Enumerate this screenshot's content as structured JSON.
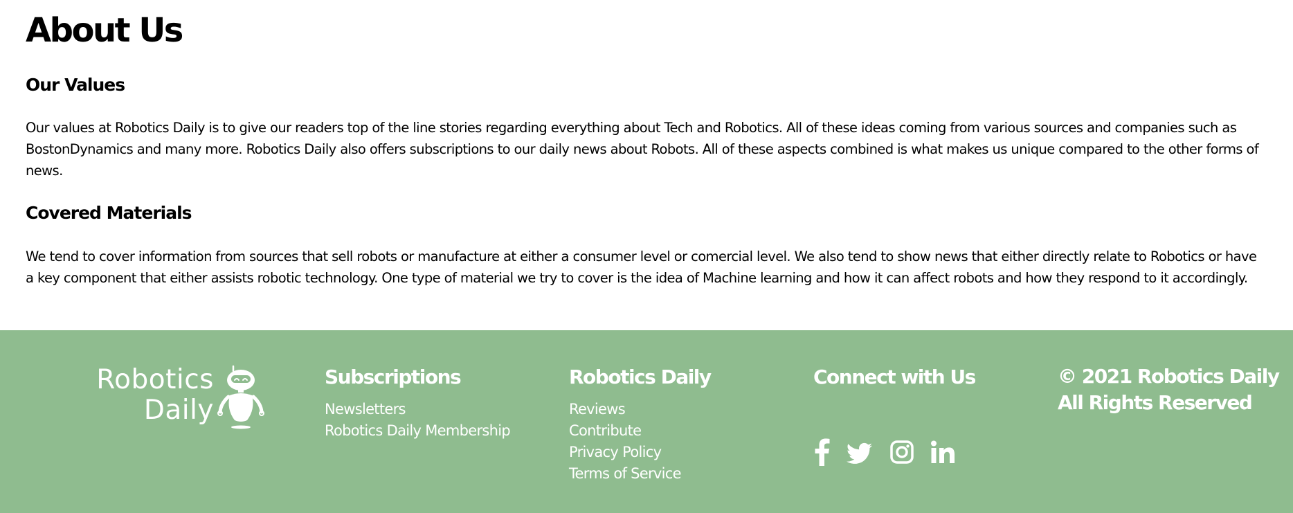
{
  "main": {
    "title": "About Us",
    "sections": [
      {
        "heading": "Our Values",
        "text": "Our values at Robotics Daily is to give our readers top of the line stories regarding everything about Tech and Robotics. All of these ideas coming from various sources and companies such as BostonDynamics and many more. Robotics Daily also offers subscriptions to our daily news about Robots. All of these aspects combined is what makes us unique compared to the other forms of news."
      },
      {
        "heading": "Covered Materials",
        "text": "We tend to cover information from sources that sell robots or manufacture at either a consumer level or comercial level. We also tend to show news that either directly relate to Robotics or have a key component that either assists robotic technology. One type of material we try to cover is the idea of Machine learning and how it can affect robots and how they respond to it accordingly."
      }
    ]
  },
  "footer": {
    "background_color": "#8fbc8f",
    "text_color": "#ffffff",
    "logo": {
      "line1": "Robotics",
      "line2": "Daily",
      "icon": "robot-icon"
    },
    "subscriptions": {
      "heading": "Subscriptions",
      "links": [
        "Newsletters",
        "Robotics Daily Membership"
      ]
    },
    "robotics_daily": {
      "heading": "Robotics Daily",
      "links": [
        "Reviews",
        "Contribute",
        "Privacy Policy",
        "Terms of Service"
      ]
    },
    "connect": {
      "heading": "Connect with Us",
      "icons": [
        "facebook-icon",
        "twitter-icon",
        "instagram-icon",
        "linkedin-icon"
      ]
    },
    "copyright": {
      "line1": "© 2021 Robotics Daily",
      "line2": "All Rights Reserved"
    }
  }
}
